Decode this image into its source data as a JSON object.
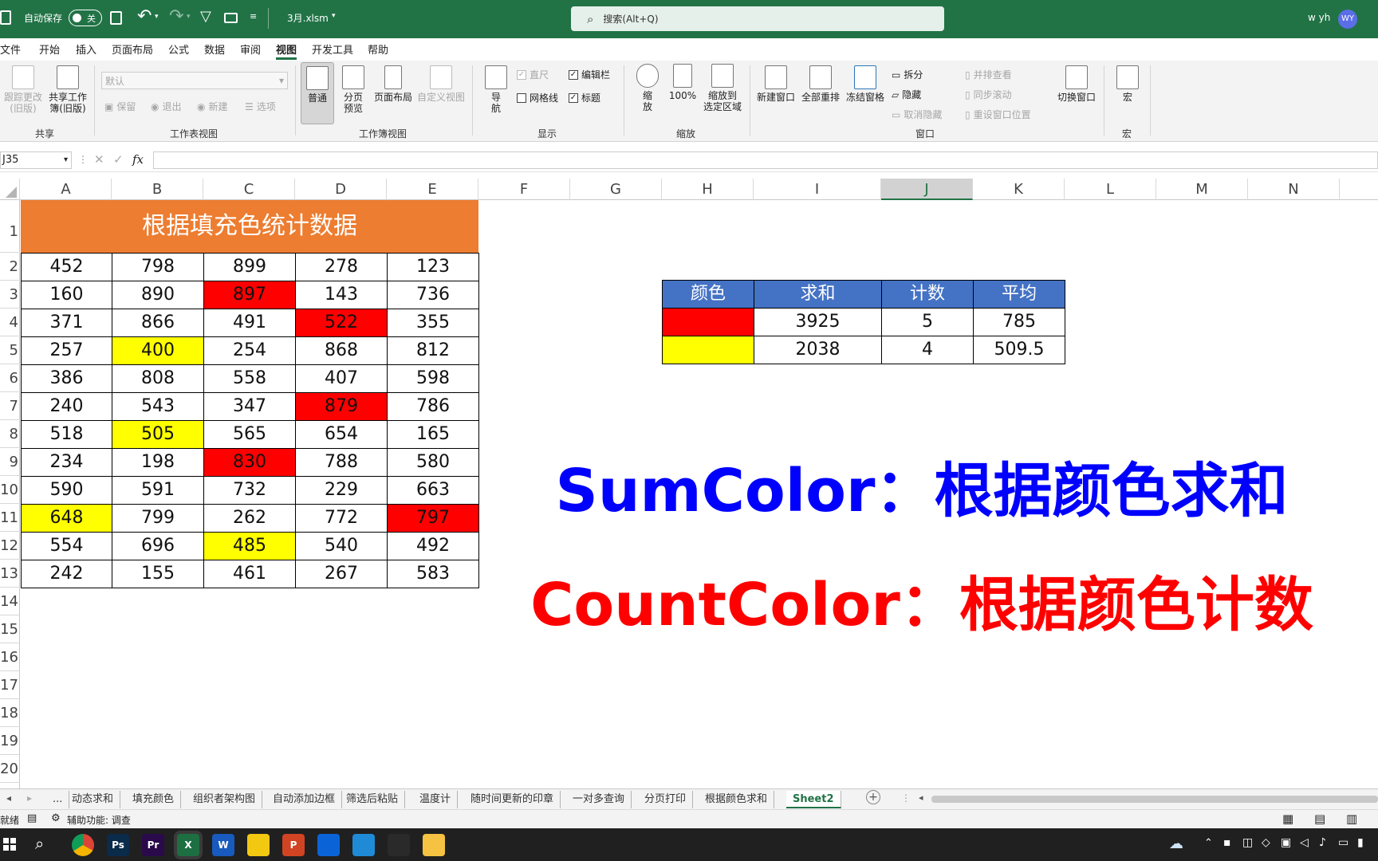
{
  "app": {
    "autosave_label": "自动保存",
    "autosave_state": "关",
    "filename": "3月.xlsm",
    "search_placeholder": "搜索(Alt+Q)",
    "user_name": "w yh",
    "user_initials": "WY",
    "brand_color": "#217346"
  },
  "ribbon_tabs": [
    "文件",
    "开始",
    "插入",
    "页面布局",
    "公式",
    "数据",
    "审阅",
    "视图",
    "开发工具",
    "帮助"
  ],
  "ribbon_active_tab": "视图",
  "ribbon": {
    "share": {
      "track_changes": "跟踪更改\n(旧版)",
      "share_workbook": "共享工作\n簿(旧版)",
      "group": "共享"
    },
    "sheet_view": {
      "dropdown": "默认",
      "keep": "保留",
      "exit": "退出",
      "new": "新建",
      "options": "选项",
      "group": "工作表视图"
    },
    "workbook_views": {
      "normal": "普通",
      "page_break": "分页\n预览",
      "page_layout": "页面布局",
      "custom": "自定义视图",
      "group": "工作簿视图"
    },
    "show": {
      "navigator": "导\n航",
      "ruler": "直尺",
      "formula_bar": "编辑栏",
      "gridlines": "网格线",
      "headings": "标题",
      "group": "显示"
    },
    "zoom": {
      "zoom": "缩\n放",
      "pct": "100%",
      "to_selection": "缩放到\n选定区域",
      "group": "缩放"
    },
    "window": {
      "new_window": "新建窗口",
      "arrange_all": "全部重排",
      "freeze": "冻结窗格",
      "split": "拆分",
      "hide": "隐藏",
      "unhide": "取消隐藏",
      "side_by_side": "并排查看",
      "sync_scroll": "同步滚动",
      "reset_position": "重设窗口位置",
      "switch": "切换窗口",
      "group": "窗口"
    },
    "macros": {
      "macros": "宏",
      "group": "宏"
    }
  },
  "formula_bar": {
    "name_box": "J35",
    "fx": "fx",
    "formula": ""
  },
  "columns": [
    "A",
    "B",
    "C",
    "D",
    "E",
    "F",
    "G",
    "H",
    "I",
    "J",
    "K",
    "L",
    "M",
    "N"
  ],
  "selected_column": "J",
  "rows": [
    "1",
    "2",
    "3",
    "4",
    "5",
    "6",
    "7",
    "8",
    "9",
    "10",
    "11",
    "12",
    "13",
    "14",
    "15",
    "16",
    "17",
    "18",
    "19",
    "20"
  ],
  "main_table": {
    "title": "根据填充色统计数据",
    "title_color": "#ed7d31",
    "rows": [
      [
        [
          "452",
          ""
        ],
        [
          "798",
          ""
        ],
        [
          "899",
          ""
        ],
        [
          "278",
          ""
        ],
        [
          "123",
          ""
        ]
      ],
      [
        [
          "160",
          ""
        ],
        [
          "890",
          ""
        ],
        [
          "897",
          "red"
        ],
        [
          "143",
          ""
        ],
        [
          "736",
          ""
        ]
      ],
      [
        [
          "371",
          ""
        ],
        [
          "866",
          ""
        ],
        [
          "491",
          ""
        ],
        [
          "522",
          "red"
        ],
        [
          "355",
          ""
        ]
      ],
      [
        [
          "257",
          ""
        ],
        [
          "400",
          "yellow"
        ],
        [
          "254",
          ""
        ],
        [
          "868",
          ""
        ],
        [
          "812",
          ""
        ]
      ],
      [
        [
          "386",
          ""
        ],
        [
          "808",
          ""
        ],
        [
          "558",
          ""
        ],
        [
          "407",
          ""
        ],
        [
          "598",
          ""
        ]
      ],
      [
        [
          "240",
          ""
        ],
        [
          "543",
          ""
        ],
        [
          "347",
          ""
        ],
        [
          "879",
          "red"
        ],
        [
          "786",
          ""
        ]
      ],
      [
        [
          "518",
          ""
        ],
        [
          "505",
          "yellow"
        ],
        [
          "565",
          ""
        ],
        [
          "654",
          ""
        ],
        [
          "165",
          ""
        ]
      ],
      [
        [
          "234",
          ""
        ],
        [
          "198",
          ""
        ],
        [
          "830",
          "red"
        ],
        [
          "788",
          ""
        ],
        [
          "580",
          ""
        ]
      ],
      [
        [
          "590",
          ""
        ],
        [
          "591",
          ""
        ],
        [
          "732",
          ""
        ],
        [
          "229",
          ""
        ],
        [
          "663",
          ""
        ]
      ],
      [
        [
          "648",
          "yellow"
        ],
        [
          "799",
          ""
        ],
        [
          "262",
          ""
        ],
        [
          "772",
          ""
        ],
        [
          "797",
          "red"
        ]
      ],
      [
        [
          "554",
          ""
        ],
        [
          "696",
          ""
        ],
        [
          "485",
          "yellow"
        ],
        [
          "540",
          ""
        ],
        [
          "492",
          ""
        ]
      ],
      [
        [
          "242",
          ""
        ],
        [
          "155",
          ""
        ],
        [
          "461",
          ""
        ],
        [
          "267",
          ""
        ],
        [
          "583",
          ""
        ]
      ]
    ]
  },
  "summary_table": {
    "headers": [
      "颜色",
      "求和",
      "计数",
      "平均"
    ],
    "header_color": "#4472c4",
    "rows": [
      {
        "color": "#ff0000",
        "sum": "3925",
        "count": "5",
        "avg": "785"
      },
      {
        "color": "#ffff00",
        "sum": "2038",
        "count": "4",
        "avg": "509.5"
      }
    ]
  },
  "captions": {
    "sum": "SumColor：根据颜色求和",
    "sum_color": "#0000ff",
    "count": "CountColor：根据颜色计数",
    "count_color": "#ff0000"
  },
  "sheet_tabs": [
    "...",
    "动态求和",
    "填充颜色",
    "组织者架构图",
    "自动添加边框",
    "筛选后粘贴",
    "温度计",
    "随时间更新的印章",
    "一对多查询",
    "分页打印",
    "根据颜色求和",
    "Sheet2"
  ],
  "active_sheet": "Sheet2",
  "status": {
    "ready": "就绪",
    "accessibility": "辅助功能: 调查"
  },
  "taskbar_apps": [
    {
      "name": "chrome",
      "label": "",
      "bg": "#2a2a2a"
    },
    {
      "name": "photoshop",
      "label": "Ps",
      "bg": "#0b2b4a"
    },
    {
      "name": "premiere",
      "label": "Pr",
      "bg": "#2a0a4a"
    },
    {
      "name": "excel",
      "label": "X",
      "bg": "#1d6f42"
    },
    {
      "name": "word",
      "label": "W",
      "bg": "#185abd"
    },
    {
      "name": "powerbi",
      "label": "",
      "bg": "#f2c811"
    },
    {
      "name": "powerpoint",
      "label": "P",
      "bg": "#d04423"
    },
    {
      "name": "meeting",
      "label": "",
      "bg": "#0a64d8"
    },
    {
      "name": "browser-q",
      "label": "",
      "bg": "#1f8bd6"
    },
    {
      "name": "qq",
      "label": "",
      "bg": "#2a2a2a"
    },
    {
      "name": "file-explorer",
      "label": "",
      "bg": "#f5c242"
    }
  ]
}
